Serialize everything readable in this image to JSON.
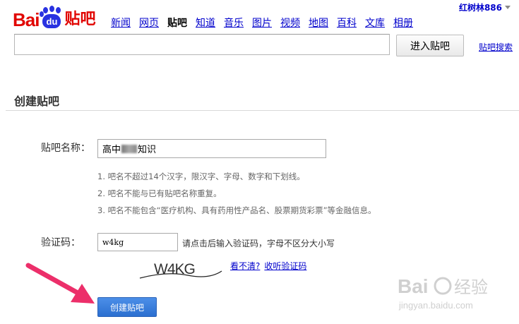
{
  "logo": {
    "left_text": "Bai",
    "paw_text": "du",
    "right_text": "贴吧"
  },
  "nav": [
    {
      "label": "新闻",
      "active": false
    },
    {
      "label": "网页",
      "active": false
    },
    {
      "label": "贴吧",
      "active": true
    },
    {
      "label": "知道",
      "active": false
    },
    {
      "label": "音乐",
      "active": false
    },
    {
      "label": "图片",
      "active": false
    },
    {
      "label": "视频",
      "active": false
    },
    {
      "label": "地图",
      "active": false
    },
    {
      "label": "百科",
      "active": false
    },
    {
      "label": "文库",
      "active": false
    },
    {
      "label": "相册",
      "active": false
    }
  ],
  "user": {
    "name": "红树林886"
  },
  "search": {
    "value": "",
    "button_label": "进入贴吧",
    "link_label": "贴吧搜索"
  },
  "section": {
    "title": "创建贴吧"
  },
  "form": {
    "name_label": "贴吧名称：",
    "name_prefix": "高中",
    "name_suffix": "知识",
    "rules": [
      "1. 吧名不超过14个汉字，限汉字、字母、数字和下划线。",
      "2. 吧名不能与已有贴吧名称重复。",
      "3. 吧名不能包含“医疗机构、具有药用性产品名、股票期货彩票”等金融信息。"
    ],
    "captcha_label": "验证码：",
    "captcha_value": "w4kg",
    "captcha_hint": "请点击后输入验证码，字母不区分大小写",
    "captcha_image_text": "W4KG",
    "unclear_link": "看不清?",
    "listen_link": "收听验证码",
    "submit_label": "创建贴吧"
  },
  "watermark": {
    "brand": "Bai",
    "brand_cn": "经验",
    "url": "jingyan.baidu.com"
  },
  "colors": {
    "brand_red": "#e10602",
    "brand_blue": "#2932e1",
    "link": "#0000cc",
    "button_blue": "#3a7ddb",
    "arrow": "#ec2f6a"
  }
}
